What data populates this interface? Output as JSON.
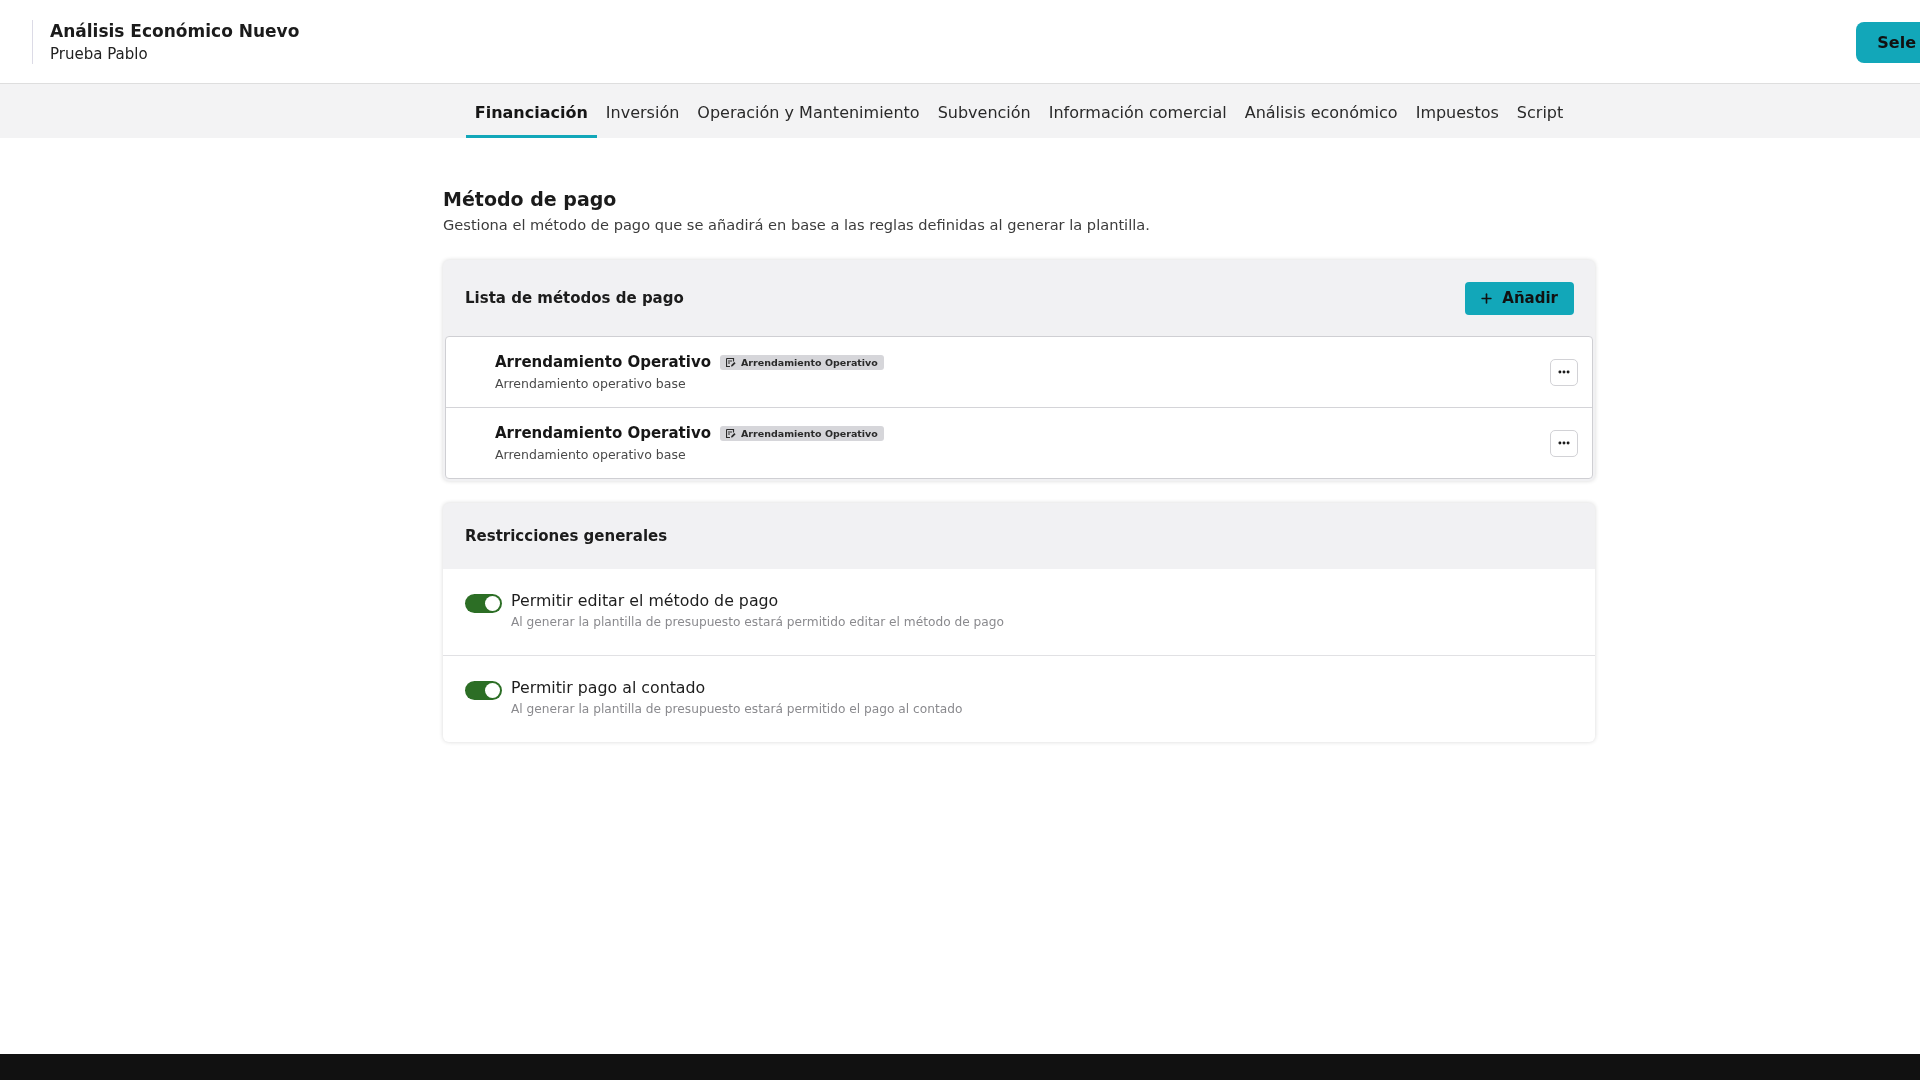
{
  "header": {
    "title": "Análisis Económico Nuevo",
    "subtitle": "Prueba Pablo",
    "action_button": "Sele"
  },
  "tabs": [
    {
      "label": "Financiación",
      "selected": true
    },
    {
      "label": "Inversión",
      "selected": false
    },
    {
      "label": "Operación y Mantenimiento",
      "selected": false
    },
    {
      "label": "Subvención",
      "selected": false
    },
    {
      "label": "Información comercial",
      "selected": false
    },
    {
      "label": "Análisis económico",
      "selected": false
    },
    {
      "label": "Impuestos",
      "selected": false
    },
    {
      "label": "Script",
      "selected": false
    }
  ],
  "section": {
    "title": "Método de pago",
    "description": "Gestiona el método de pago que se añadirá en base a las reglas definidas al generar la plantilla."
  },
  "payment_methods": {
    "title": "Lista de métodos de pago",
    "add_button": "Añadir",
    "items": [
      {
        "name": "Arrendamiento Operativo",
        "tag": "Arrendamiento Operativo",
        "description": "Arrendamiento operativo base"
      },
      {
        "name": "Arrendamiento Operativo",
        "tag": "Arrendamiento Operativo",
        "description": "Arrendamiento operativo base"
      }
    ]
  },
  "restrictions": {
    "title": "Restricciones generales",
    "items": [
      {
        "label": "Permitir editar el método de pago",
        "description": "Al generar la plantilla de presupuesto estará permitido editar el método de pago",
        "on": true
      },
      {
        "label": "Permitir pago al contado",
        "description": "Al generar la plantilla de presupuesto estará permitido el pago al contado",
        "on": true
      }
    ]
  }
}
